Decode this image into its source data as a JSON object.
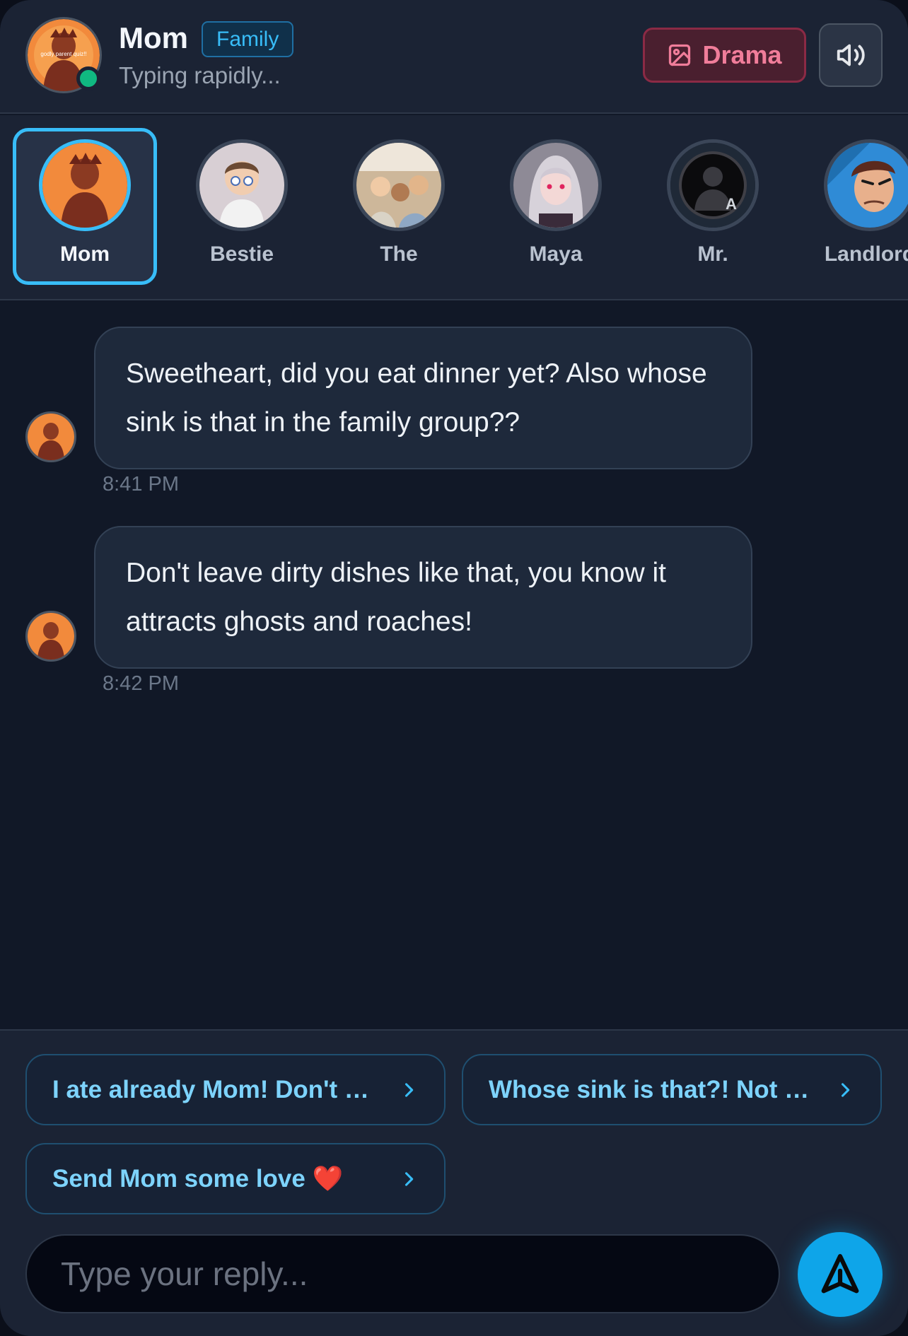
{
  "header": {
    "name": "Mom",
    "tag": "Family",
    "status": "Typing rapidly...",
    "drama_label": "Drama",
    "avatar_text": "godly parent quiz!!"
  },
  "contacts": [
    {
      "name": "Mom",
      "active": true
    },
    {
      "name": "Bestie",
      "active": false
    },
    {
      "name": "The",
      "active": false
    },
    {
      "name": "Maya",
      "active": false
    },
    {
      "name": "Mr.",
      "active": false
    },
    {
      "name": "Landlord",
      "active": false
    }
  ],
  "messages": [
    {
      "text": "Sweetheart, did you eat dinner yet? Also whose sink is that in the family group??",
      "time": "8:41 PM"
    },
    {
      "text": "Don't leave dirty dishes like that, you know it attracts ghosts and roaches!",
      "time": "8:42 PM"
    }
  ],
  "quick_replies": [
    "I ate already Mom! Don't worry",
    "Whose sink is that?! Not mine!",
    "Send Mom some love ❤️"
  ],
  "composer": {
    "placeholder": "Type your reply..."
  },
  "icons": {
    "drama": "image-icon",
    "sound": "speaker-icon",
    "send": "send-icon",
    "chevron": "chevron-right-icon"
  },
  "colors": {
    "accent": "#38bdf8",
    "drama": "#f07d9a",
    "online": "#10b981",
    "send": "#0ea5e9"
  }
}
